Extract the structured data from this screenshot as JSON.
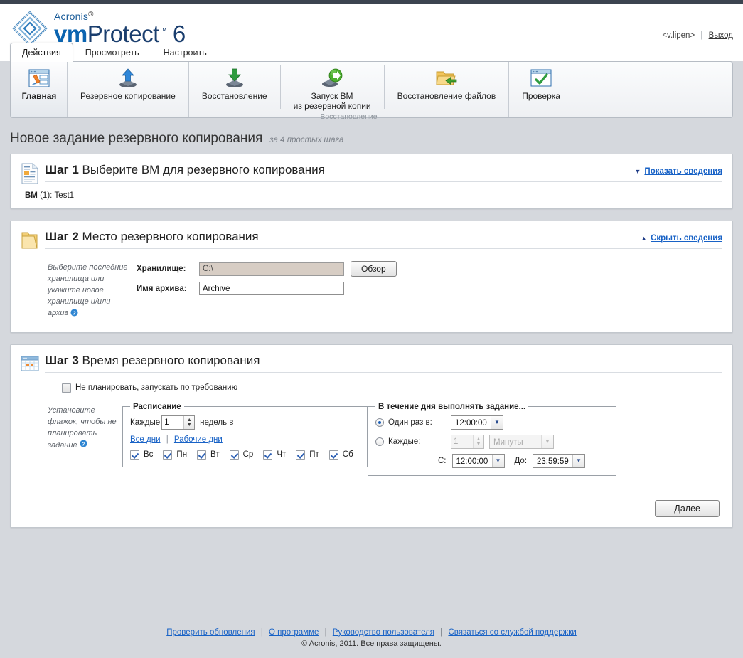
{
  "brand": {
    "acronis": "Acronis",
    "product_prefix": "vm",
    "product_rest": "Protect",
    "product_version": "6",
    "logo_icon": "acronis-diamond-logo"
  },
  "userbar": {
    "user": "<v.lipen>",
    "separator": "|",
    "logout": "Выход"
  },
  "tabs": [
    {
      "label": "Действия",
      "active": true
    },
    {
      "label": "Просмотреть",
      "active": false
    },
    {
      "label": "Настроить",
      "active": false
    }
  ],
  "ribbon": {
    "home": {
      "label": "Главная",
      "icon": "home-window-pencil-icon"
    },
    "backup": {
      "label": "Резервное копирование",
      "icon": "upload-arrow-icon"
    },
    "group_caption": "Восстановление",
    "restore_items": [
      {
        "label": "Восстановление",
        "icon": "download-arrow-icon"
      },
      {
        "label": "Запуск ВМ\nиз резервной копии",
        "line1": "Запуск ВМ",
        "line2": "из резервной копии",
        "icon": "run-vm-green-arrow-icon"
      },
      {
        "label": "Восстановление файлов",
        "icon": "folder-restore-icon"
      }
    ],
    "validate": {
      "label": "Проверка",
      "icon": "validate-checkmark-window-icon"
    }
  },
  "page": {
    "title": "Новое задание резервного копирования",
    "subtitle": "за 4 простых шага"
  },
  "step1": {
    "icon": "document-list-icon",
    "step_label": "Шаг 1",
    "title": "Выберите ВМ для резервного копирования",
    "toggle": {
      "caret": "▼",
      "label": "Показать сведения"
    },
    "vm_label": "ВМ",
    "vm_count": "(1):",
    "vm_names": "Test1"
  },
  "step2": {
    "icon": "folder-icon",
    "step_label": "Шаг 2",
    "title": "Место резервного копирования",
    "toggle": {
      "caret": "▲",
      "label": "Скрыть сведения"
    },
    "hint": "Выберите последние хранилища или укажите новое хранилище и/или архив",
    "hint_help_icon": "help-question-icon",
    "storage_label": "Хранилище:",
    "storage_value": "C:\\",
    "browse_button": "Обзор",
    "archive_label": "Имя архива:",
    "archive_value": "Archive"
  },
  "step3": {
    "icon": "calendar-icon",
    "step_label": "Шаг 3",
    "title": "Время резервного копирования",
    "no_schedule": {
      "label": "Не планировать, запускать по требованию",
      "checked": false
    },
    "hint": "Установите флажок, чтобы не планировать задание",
    "hint_help_icon": "help-question-icon",
    "schedule_box": {
      "legend": "Расписание",
      "every_label": "Каждые",
      "every_value": "1",
      "weeks_label": "недель в",
      "all_days_link": "Все дни",
      "link_sep": "|",
      "workdays_link": "Рабочие дни",
      "days": [
        {
          "label": "Вс",
          "checked": true
        },
        {
          "label": "Пн",
          "checked": true
        },
        {
          "label": "Вт",
          "checked": true
        },
        {
          "label": "Ср",
          "checked": true
        },
        {
          "label": "Чт",
          "checked": true
        },
        {
          "label": "Пт",
          "checked": true
        },
        {
          "label": "Сб",
          "checked": true
        }
      ]
    },
    "day_box": {
      "legend": "В течение дня выполнять задание...",
      "once_label": "Один раз в:",
      "once_selected": true,
      "once_time": "12:00:00",
      "every_label": "Каждые:",
      "every_selected": false,
      "every_count": "1",
      "every_unit": "Минуты",
      "from_label": "С:",
      "from_time": "12:00:00",
      "to_label": "До:",
      "to_time": "23:59:59"
    },
    "next_button": "Далее"
  },
  "footer": {
    "links": [
      "Проверить обновления",
      "О программе",
      "Руководство пользователя",
      "Связаться со службой поддержки"
    ],
    "separator": "|",
    "copyright": "© Acronis, 2011. Все права защищены."
  },
  "colors": {
    "accent_link": "#1862c6",
    "brand_blue": "#0b64b0",
    "brand_dark": "#1a3e6e",
    "page_bg": "#d5d8dd",
    "readonly_field": "#d7cdc4"
  }
}
